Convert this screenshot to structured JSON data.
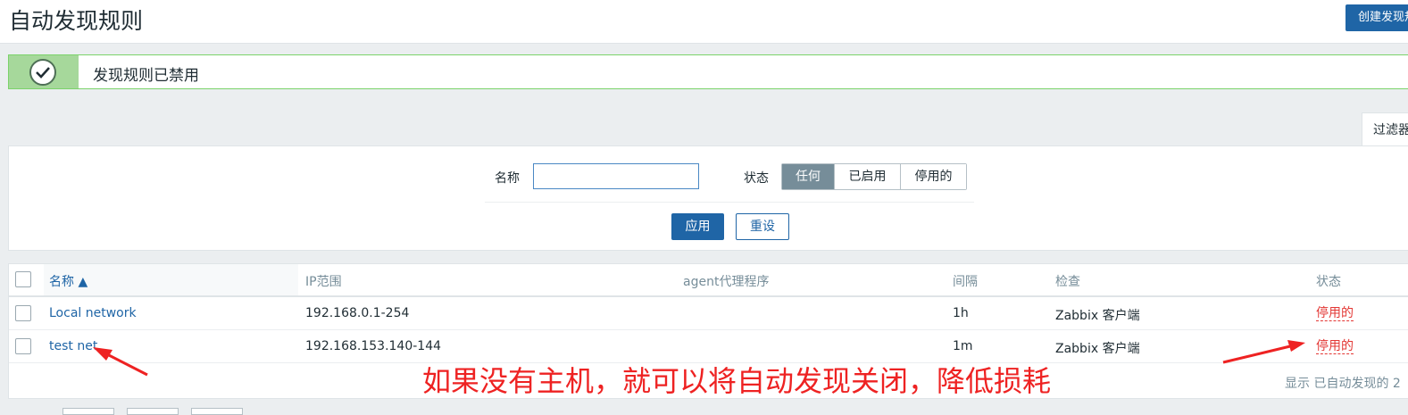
{
  "header": {
    "title": "自动发现规则",
    "create_button": "创建发现规则"
  },
  "message": {
    "text": "发现规则已禁用",
    "icon": "check-circle-icon"
  },
  "filter": {
    "tab_label": "过滤器",
    "name_label": "名称",
    "name_value": "",
    "status_label": "状态",
    "status_options": [
      "任何",
      "已启用",
      "停用的"
    ],
    "status_selected": "任何",
    "apply_label": "应用",
    "reset_label": "重设"
  },
  "table": {
    "columns": [
      "名称 ▲",
      "IP范围",
      "agent代理程序",
      "间隔",
      "检查",
      "状态"
    ],
    "rows": [
      {
        "name": "Local network",
        "ip_range": "192.168.0.1-254",
        "proxy": "",
        "interval": "1h",
        "checks": "Zabbix 客户端",
        "status": "停用的"
      },
      {
        "name": "test net",
        "ip_range": "192.168.153.140-144",
        "proxy": "",
        "interval": "1m",
        "checks": "Zabbix 客户端",
        "status": "停用的"
      }
    ],
    "footer": "显示 已自动发现的 2"
  },
  "annotation": {
    "text": "如果没有主机，就可以将自动发现关闭，降低损耗",
    "color": "#ee2222"
  },
  "colors": {
    "accent": "#1f65a6",
    "success": "#7bd36a",
    "disabled": "#e33734"
  }
}
